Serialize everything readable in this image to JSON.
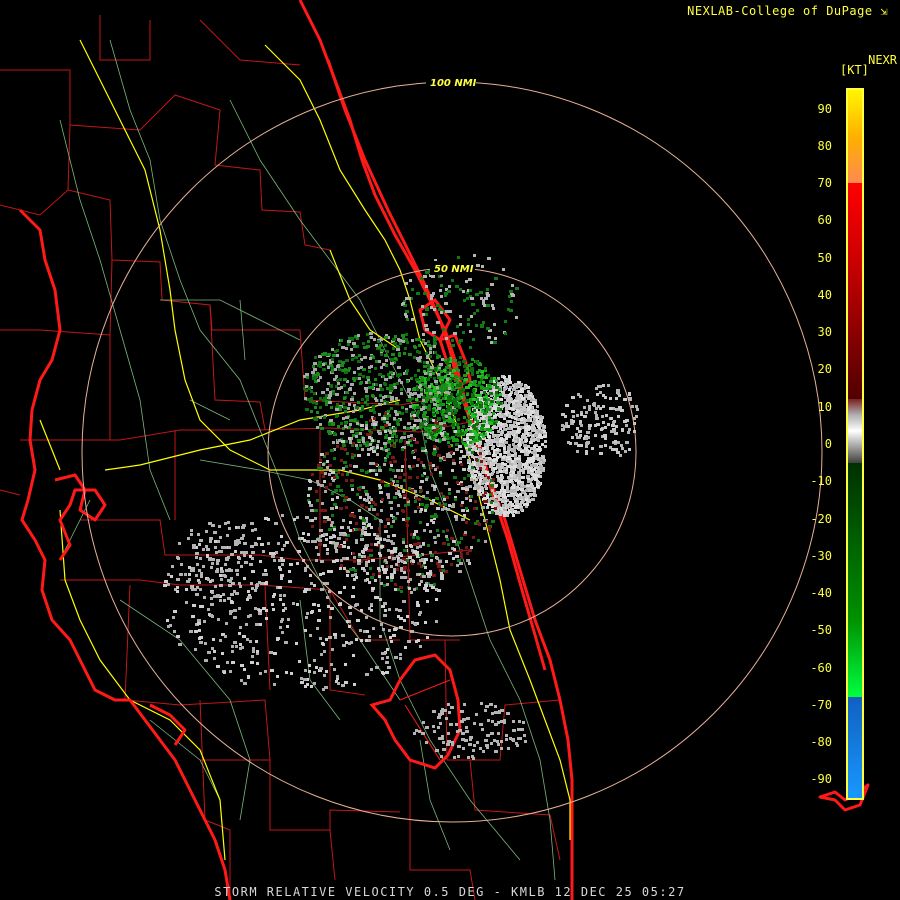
{
  "header": {
    "credit": "NEXLAB-College of DuPage ⇲",
    "product": "NEXR",
    "unit": "[KT]"
  },
  "colors": {
    "background": "#000000",
    "county_lines": "#c01818",
    "coastline": "#ff1a1a",
    "roads": "#ffff00",
    "rivers": "#8fd88f",
    "range_rings": "#e8b098",
    "label_text": "#ffff40",
    "footer_text": "#d8d8d8"
  },
  "range_rings": [
    {
      "label": "100 NMI",
      "radius_nmi": 100
    },
    {
      "label": "50 NMI",
      "radius_nmi": 50
    }
  ],
  "color_scale": {
    "unit": "KT",
    "min": -95,
    "max": 95,
    "ticks": [
      90,
      80,
      70,
      60,
      50,
      40,
      30,
      20,
      10,
      0,
      -10,
      -20,
      -30,
      -40,
      -50,
      -60,
      -70,
      -80,
      -90
    ],
    "bands": [
      {
        "from": 95,
        "to": 70,
        "colors": [
          "#fff600",
          "#ffb000",
          "#ff8a50"
        ]
      },
      {
        "from": 70,
        "to": 12,
        "colors": [
          "#ff0000",
          "#d00000",
          "#900000",
          "#500000"
        ]
      },
      {
        "from": 12,
        "to": -5,
        "colors": [
          "#7a2020",
          "#b0b0b0",
          "#ffffff",
          "#a0a0a0",
          "#404040"
        ]
      },
      {
        "from": -5,
        "to": -68,
        "colors": [
          "#003000",
          "#006000",
          "#009000",
          "#00ff40"
        ]
      },
      {
        "from": -68,
        "to": -95,
        "colors": [
          "#1060c0",
          "#1898ff"
        ]
      }
    ]
  },
  "footer": {
    "title": "STORM RELATIVE VELOCITY 0.5 DEG - KMLB 12 DEC 25 05:27"
  }
}
